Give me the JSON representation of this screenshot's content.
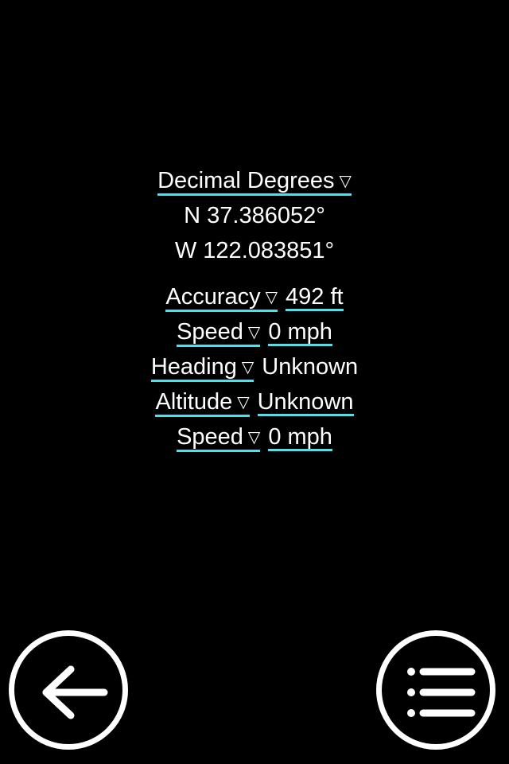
{
  "format": {
    "label": "Decimal Degrees",
    "dropdown_icon": "▽"
  },
  "coordinates": {
    "latitude": "N 37.386052°",
    "longitude": "W 122.083851°"
  },
  "rows": [
    {
      "label": "Accuracy",
      "value": "492 ft",
      "value_linked": true
    },
    {
      "label": "Speed",
      "value": "0 mph",
      "value_linked": true
    },
    {
      "label": "Heading",
      "value": "Unknown",
      "value_linked": false
    },
    {
      "label": "Altitude",
      "value": "Unknown",
      "value_linked": true
    },
    {
      "label": "Speed",
      "value": "0 mph",
      "value_linked": true
    }
  ],
  "controls": {
    "back_icon": "arrow-left-icon",
    "menu_icon": "menu-list-icon"
  },
  "colors": {
    "background": "#000000",
    "text": "#ffffff",
    "underline_accent": "#4fe0ea"
  }
}
